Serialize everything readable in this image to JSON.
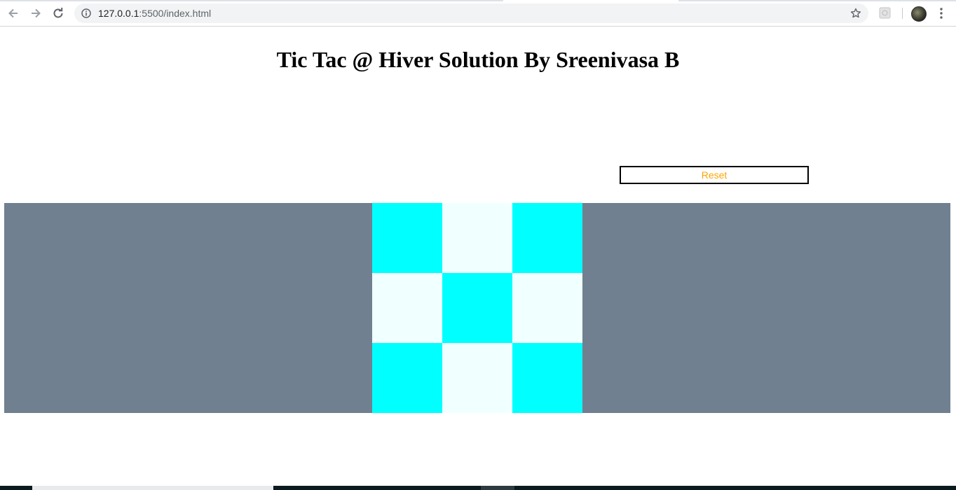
{
  "browser": {
    "url_host": "127.0.0.1",
    "url_path": ":5500/index.html"
  },
  "page": {
    "title": "Tic Tac @ Hiver Solution By Sreenivasa B",
    "reset_label": "Reset"
  },
  "colors": {
    "board_background": "#708090",
    "cell_dark": "#00ffff",
    "cell_light": "#f0ffff",
    "reset_text": "#ffa500"
  },
  "board": {
    "cells": [
      {
        "shade": "dark"
      },
      {
        "shade": "light"
      },
      {
        "shade": "dark"
      },
      {
        "shade": "light"
      },
      {
        "shade": "dark"
      },
      {
        "shade": "light"
      },
      {
        "shade": "dark"
      },
      {
        "shade": "light"
      },
      {
        "shade": "dark"
      }
    ]
  },
  "icons": {
    "back": "back-arrow-icon",
    "forward": "forward-arrow-icon",
    "reload": "reload-icon",
    "site_info": "info-icon",
    "bookmark": "star-icon",
    "extension": "extension-icon",
    "profile": "avatar",
    "menu": "kebab-menu-icon"
  }
}
